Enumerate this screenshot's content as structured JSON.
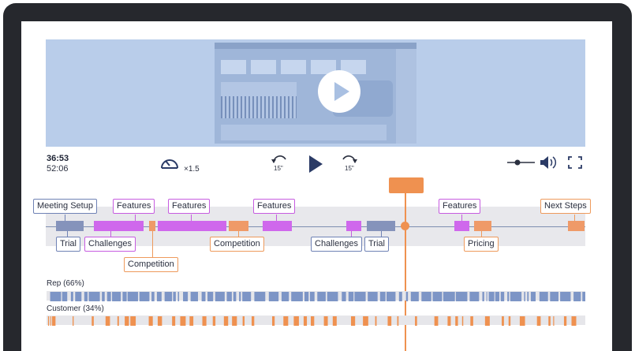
{
  "player": {
    "current_time": "36:53",
    "total_time": "52:06",
    "speed": "×1.5",
    "skip_back": "15\"",
    "skip_forward": "15\"",
    "play_icon": "play-icon",
    "volume_level": 0.35
  },
  "colors": {
    "rep": "#7d95c6",
    "customer": "#ef9150",
    "blue_topic": "#8593bb",
    "purple_topic": "#cf68ec",
    "orange_topic": "#ef9a68",
    "track_bg": "#e8e8ec",
    "video_bg": "#b9cdea"
  },
  "timeline": {
    "position_fraction": 0.666,
    "labels": {
      "meeting_setup": "Meeting Setup",
      "features_1": "Features",
      "features_2": "Features",
      "features_3": "Features",
      "features_4": "Features",
      "next_steps": "Next Steps",
      "trial_1": "Trial",
      "challenges_1": "Challenges",
      "competition_1": "Competition",
      "competition_2": "Competition",
      "challenges_2": "Challenges",
      "trial_2": "Trial",
      "pricing": "Pricing"
    }
  },
  "speakers": {
    "rep_label": "Rep (66%)",
    "customer_label": "Customer (34%)"
  }
}
